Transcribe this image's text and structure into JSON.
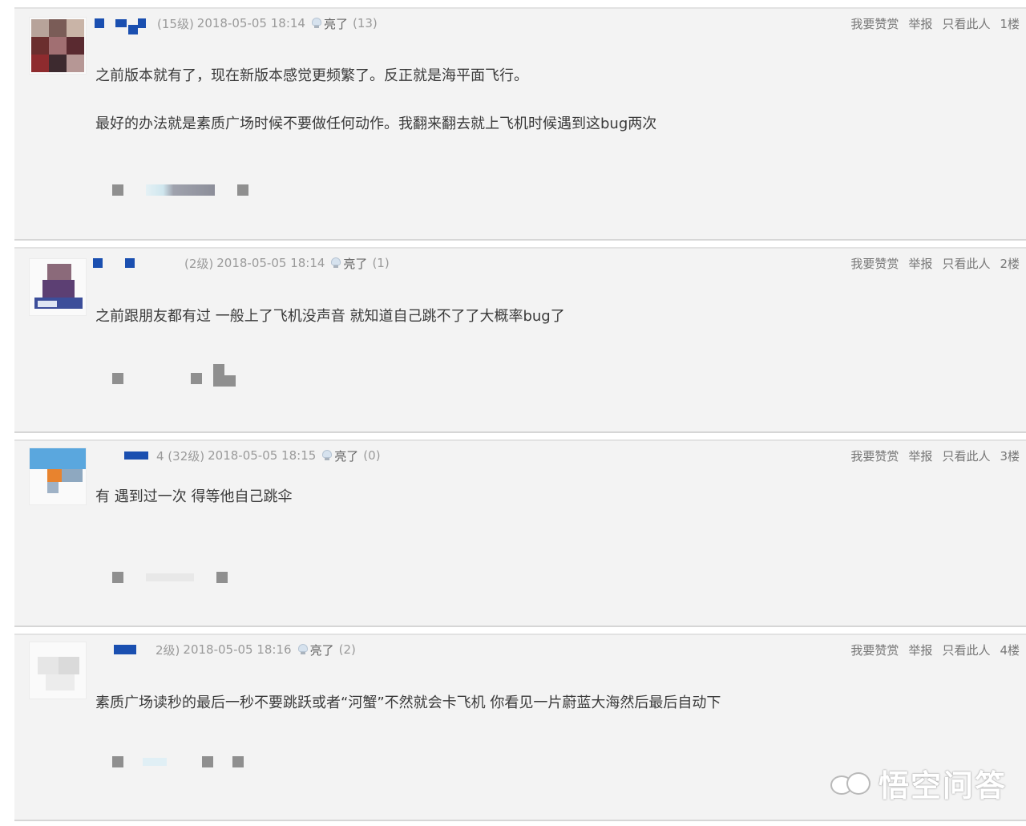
{
  "posts": [
    {
      "level": "(15级)",
      "timestamp": "2018-05-05 18:14",
      "liang_label": "亮了",
      "liang_count": "(13)",
      "actions": {
        "reward": "我要赞赏",
        "report": "举报",
        "only_this": "只看此人"
      },
      "floor": "1楼",
      "lines": [
        "之前版本就有了，现在新版本感觉更频繁了。反正就是海平面飞行。",
        "最好的办法就是素质广场时候不要做任何动作。我翻来翻去就上飞机时候遇到这bug两次"
      ]
    },
    {
      "level": "(2级)",
      "timestamp": "2018-05-05 18:14",
      "liang_label": "亮了",
      "liang_count": "(1)",
      "actions": {
        "reward": "我要赞赏",
        "report": "举报",
        "only_this": "只看此人"
      },
      "floor": "2楼",
      "lines": [
        "之前跟朋友都有过 一般上了飞机没声音 就知道自己跳不了了大概率bug了"
      ]
    },
    {
      "level": "4 (32级)",
      "timestamp": "2018-05-05 18:15",
      "liang_label": "亮了",
      "liang_count": "(0)",
      "actions": {
        "reward": "我要赞赏",
        "report": "举报",
        "only_this": "只看此人"
      },
      "floor": "3楼",
      "lines": [
        "有 遇到过一次 得等他自己跳伞"
      ]
    },
    {
      "level": "2级)",
      "timestamp": "2018-05-05 18:16",
      "liang_label": "亮了",
      "liang_count": "(2)",
      "actions": {
        "reward": "我要赞赏",
        "report": "举报",
        "only_this": "只看此人"
      },
      "floor": "4楼",
      "lines": [
        "素质广场读秒的最后一秒不要跳跃或者“河蟹”不然就会卡飞机 你看见一片蔚蓝大海然后最后自动下"
      ]
    }
  ],
  "watermark": {
    "text": "悟空问答",
    "icon": "wukong-logo-icon"
  },
  "colors": {
    "post_bg": "#f3f3f3",
    "username_blue": "#1a4fb0"
  }
}
